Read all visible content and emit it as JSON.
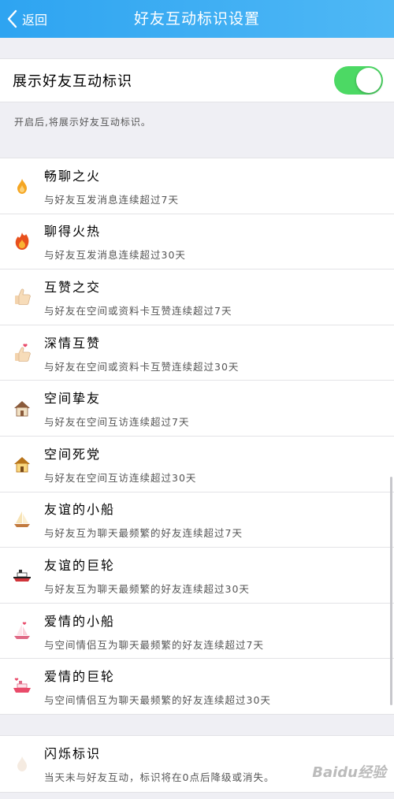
{
  "header": {
    "back_label": "返回",
    "title": "好友互动标识设置"
  },
  "toggle": {
    "label": "展示好友互动标识",
    "state": "on",
    "color": "#4cd964"
  },
  "hint": "开启后,将展示好友互动标识。",
  "items": [
    {
      "icon": "flame-small-icon",
      "name": "畅聊之火",
      "desc": "与好友互发消息连续超过7天"
    },
    {
      "icon": "flame-big-icon",
      "name": "聊得火热",
      "desc": "与好友互发消息连续超过30天"
    },
    {
      "icon": "thumbs-up-icon",
      "name": "互赞之交",
      "desc": "与好友在空间或资料卡互赞连续超过7天"
    },
    {
      "icon": "thumbs-up-heart-icon",
      "name": "深情互赞",
      "desc": "与好友在空间或资料卡互赞连续超过30天"
    },
    {
      "icon": "house-icon",
      "name": "空间挚友",
      "desc": "与好友在空间互访连续超过7天"
    },
    {
      "icon": "house-gold-icon",
      "name": "空间死党",
      "desc": "与好友在空间互访连续超过30天"
    },
    {
      "icon": "sailboat-icon",
      "name": "友谊的小船",
      "desc": "与好友互为聊天最频繁的好友连续超过7天"
    },
    {
      "icon": "ship-icon",
      "name": "友谊的巨轮",
      "desc": "与好友互为聊天最频繁的好友连续超过30天"
    },
    {
      "icon": "love-boat-icon",
      "name": "爱情的小船",
      "desc": "与空间情侣互为聊天最频繁的好友连续超过7天"
    },
    {
      "icon": "love-ship-icon",
      "name": "爱情的巨轮",
      "desc": "与空间情侣互为聊天最频繁的好友连续超过30天"
    }
  ],
  "flash": {
    "icon": "pale-flame-icon",
    "name": "闪烁标识",
    "desc": "当天未与好友互动，标识将在0点后降级或消失。"
  },
  "watermark": "Baidu经验"
}
